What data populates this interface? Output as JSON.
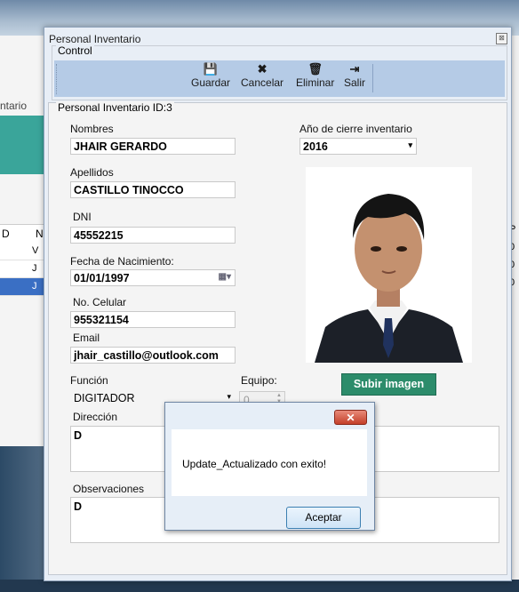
{
  "background_window": {
    "tab_fragment": "ntario",
    "grid_header_fragments": [
      "D",
      "N"
    ],
    "grid_cells": [
      "V",
      "J",
      "J"
    ],
    "right_fragments": [
      "P",
      "0",
      "0",
      "0"
    ]
  },
  "window": {
    "title": "Personal Inventario",
    "close_glyph": "⊠"
  },
  "control": {
    "legend": "Control",
    "buttons": [
      {
        "name": "guardar",
        "label": "Guardar",
        "icon": "save-icon",
        "glyph": "💾"
      },
      {
        "name": "cancelar",
        "label": "Cancelar",
        "icon": "cancel-icon",
        "glyph": "✖"
      },
      {
        "name": "eliminar",
        "label": "Eliminar",
        "icon": "trash-icon",
        "glyph": "🗑"
      },
      {
        "name": "salir",
        "label": "Salir",
        "icon": "exit-icon",
        "glyph": "⇥"
      }
    ]
  },
  "form": {
    "legend": "Personal Inventario ID:3",
    "nombres_label": "Nombres",
    "nombres_value": "JHAIR GERARDO",
    "apellidos_label": "Apellidos",
    "apellidos_value": "CASTILLO TINOCCO",
    "dni_label": "DNI",
    "dni_value": "45552215",
    "fecha_label": "Fecha de Nacimiento:",
    "fecha_value": "01/01/1997",
    "celular_label": "No. Celular",
    "celular_value": "955321154",
    "email_label": "Email",
    "email_value": "jhair_castillo@outlook.com",
    "anio_label": "Año de cierre inventario",
    "anio_value": "2016",
    "upload_button": "Subir imagen",
    "funcion_label": "Función",
    "funcion_value": "DIGITADOR",
    "equipo_label": "Equipo:",
    "equipo_value": "0",
    "direccion_label": "Dirección",
    "direccion_value": "D",
    "observaciones_label": "Observaciones",
    "observaciones_value": "D"
  },
  "dialog": {
    "message": "Update_Actualizado con exito!",
    "ok_button": "Aceptar",
    "close_glyph": "✕"
  },
  "colors": {
    "toolbar": "#b5cbe6",
    "upload_button": "#2c8c6b",
    "teal_background": "#3aa59a"
  }
}
